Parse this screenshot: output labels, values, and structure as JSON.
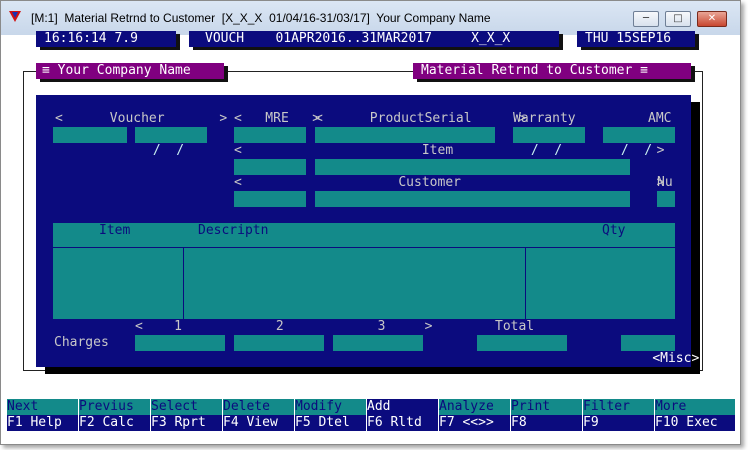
{
  "window": {
    "title": "[M:1]  Material Retrnd to Customer  [X_X_X  01/04/16-31/03/17]  Your Company Name",
    "min_symbol": "─",
    "max_symbol": "□",
    "close_symbol": "✕"
  },
  "status": {
    "time": "16:16:14 7.9",
    "vouch": "VOUCH    01APR2016..31MAR2017     X_X_X",
    "date": "THU 15SEP16"
  },
  "headers": {
    "company": "≡ Your Company Name",
    "form": "Material Retrnd to Customer ≡"
  },
  "form": {
    "voucher_label": "<      Voucher       >",
    "voucher_date": " /  /",
    "mre_label": "<   MRE   >",
    "product_serial_label": "<      ProductSerial      >",
    "warranty_label": "Warranty",
    "warranty_date": " /  /",
    "amc_label": "AMC",
    "amc_date": " /  /",
    "item_label": "<                       Item                          >",
    "customer_label": "<                    Customer                         >",
    "nu_label": "Nu",
    "grid_col_item": "Item",
    "grid_col_desc": "Descriptn",
    "grid_col_qty": "Qty",
    "charges_nav": "<    1            2            3     >",
    "total_label": "Total",
    "charges_label": "Charges",
    "misc_button": "<Misc>"
  },
  "fkeys": [
    {
      "top": "Next",
      "bot": "F1 Help"
    },
    {
      "top": "Previus",
      "bot": "F2 Calc"
    },
    {
      "top": "Select",
      "bot": "F3 Rprt"
    },
    {
      "top": "Delete",
      "bot": "F4 View"
    },
    {
      "top": "Modify",
      "bot": "F5 Dtel"
    },
    {
      "top": "Add",
      "bot": "F6 Rltd"
    },
    {
      "top": "Analyze",
      "bot": "F7 <<>>"
    },
    {
      "top": "Print",
      "bot": "F8"
    },
    {
      "top": "Filter",
      "bot": "F9"
    },
    {
      "top": "More",
      "bot": "F10 Exec"
    }
  ],
  "colors": {
    "panel": "#0b0b7e",
    "field": "#138a8a",
    "header": "#800080"
  }
}
